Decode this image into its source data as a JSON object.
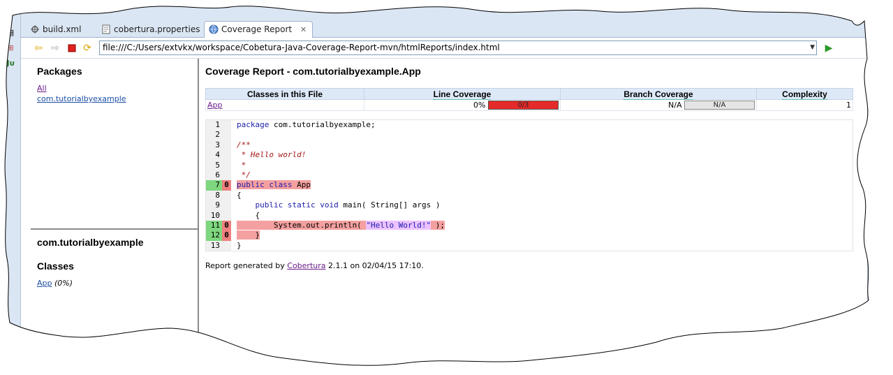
{
  "tabs": [
    {
      "label": "build.xml",
      "active": false
    },
    {
      "label": "cobertura.properties",
      "active": false
    },
    {
      "label": "Coverage Report",
      "active": true
    }
  ],
  "toolbar": {
    "url": "file:///C:/Users/extvkx/workspace/Cobetura-Java-Coverage-Report-mvn/htmlReports/index.html"
  },
  "packages": {
    "heading": "Packages",
    "items": [
      "All",
      "com.tutorialbyexample"
    ]
  },
  "package_classes": {
    "package_name": "com.tutorialbyexample",
    "heading": "Classes",
    "class_name": "App",
    "class_pct": "(0%)"
  },
  "report": {
    "title": "Coverage Report - com.tutorialbyexample.App",
    "columns": [
      "Classes in this File",
      "Line Coverage",
      "Branch Coverage",
      "Complexity"
    ],
    "row": {
      "class": "App",
      "line_pct": "0%",
      "line_bar": "0/3",
      "branch_pct": "N/A",
      "branch_bar": "N/A",
      "complexity": "1"
    },
    "source_lines": [
      {
        "n": "1",
        "hits": "",
        "text": "package com.tutorialbyexample;"
      },
      {
        "n": "2",
        "hits": "",
        "text": ""
      },
      {
        "n": "3",
        "hits": "",
        "text": "/**"
      },
      {
        "n": "4",
        "hits": "",
        "text": " * Hello world!"
      },
      {
        "n": "5",
        "hits": "",
        "text": " *"
      },
      {
        "n": "6",
        "hits": "",
        "text": " */"
      },
      {
        "n": "7",
        "hits": "0",
        "text": "public class App"
      },
      {
        "n": "8",
        "hits": "",
        "text": "{"
      },
      {
        "n": "9",
        "hits": "",
        "text": "    public static void main( String[] args )"
      },
      {
        "n": "10",
        "hits": "",
        "text": "    {"
      },
      {
        "n": "11",
        "hits": "0",
        "text": "        System.out.println( \"Hello World!\" );"
      },
      {
        "n": "12",
        "hits": "0",
        "text": "    }"
      },
      {
        "n": "13",
        "hits": "",
        "text": "}"
      }
    ],
    "footer": {
      "prefix": "Report generated by",
      "tool": "Cobertura",
      "suffix": "2.1.1 on 02/04/15 17:10."
    }
  },
  "colors": {
    "covered_bar": "#e52a2a",
    "hit_line": "#7ed77e",
    "miss_hits": "#f08080"
  }
}
